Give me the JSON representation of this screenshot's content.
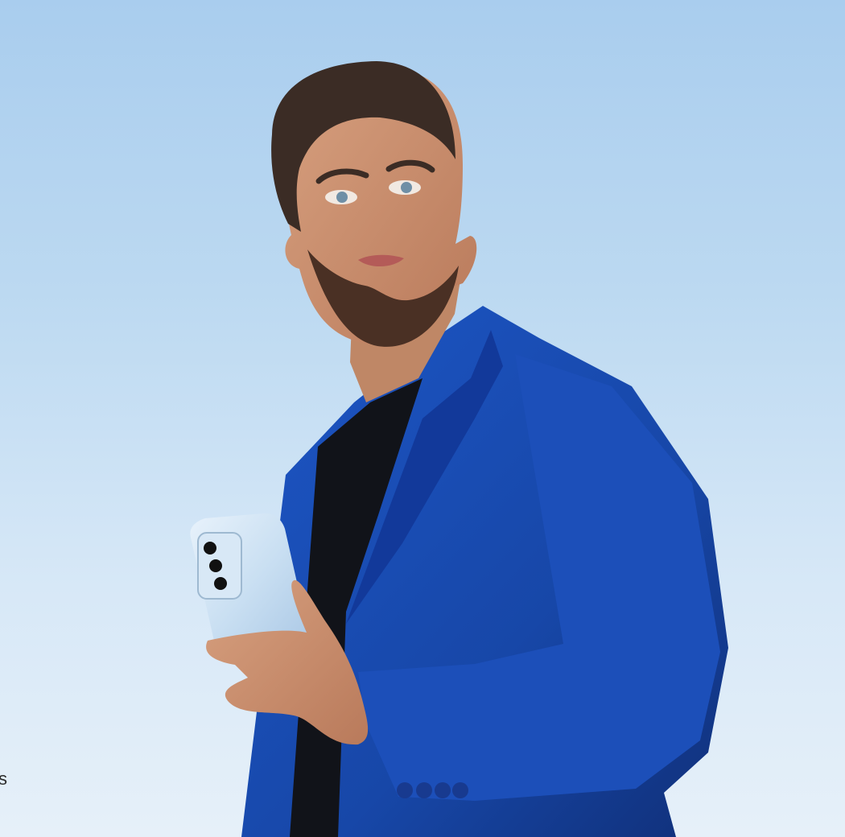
{
  "image": {
    "background_top": "#a9cdee",
    "background_bottom": "#e6f0f9",
    "jacket_color": "#1747a8",
    "phone_color": "#c9dff2"
  },
  "edge_text": "s"
}
